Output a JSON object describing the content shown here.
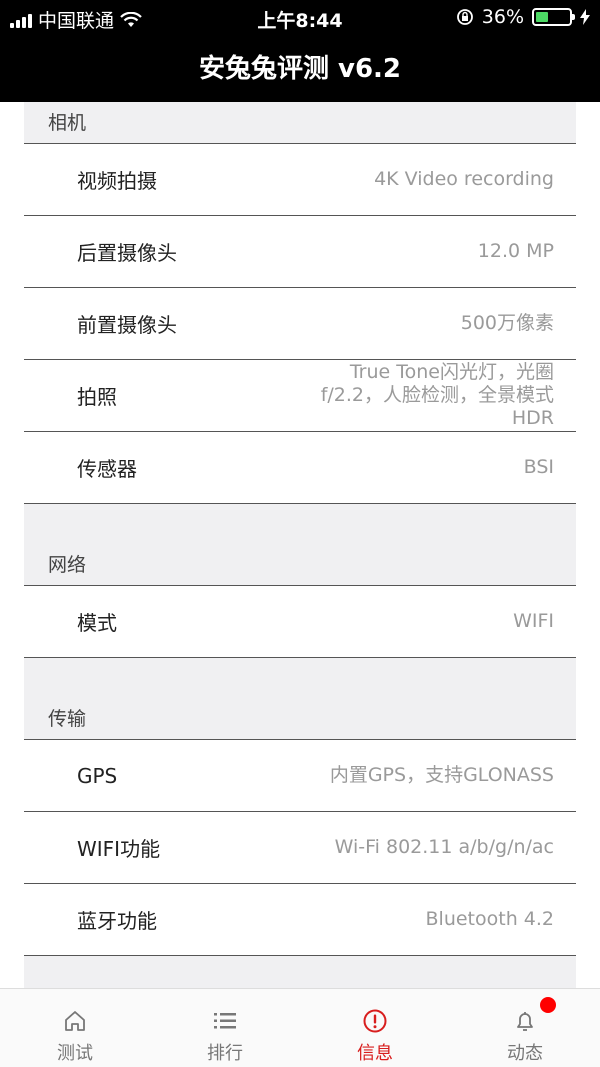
{
  "status_bar": {
    "carrier": "中国联通",
    "time": "上午8:44",
    "battery": "36%",
    "battery_level": 0.36
  },
  "navbar": {
    "title": "安兔兔评测 v6.2"
  },
  "sections": [
    {
      "header": "相机",
      "rows": [
        {
          "label": "视频拍摄",
          "value": "4K Video recording"
        },
        {
          "label": "后置摄像头",
          "value": "12.0 MP"
        },
        {
          "label": "前置摄像头",
          "value": "500万像素"
        },
        {
          "label": "拍照",
          "value": "True Tone闪光灯，光圈f/2.2，人脸检测，全景模式HDR"
        },
        {
          "label": "传感器",
          "value": "BSI"
        }
      ]
    },
    {
      "header": "网络",
      "rows": [
        {
          "label": "模式",
          "value": "WIFI"
        }
      ]
    },
    {
      "header": "传输",
      "rows": [
        {
          "label": "GPS",
          "value": "内置GPS，支持GLONASS"
        },
        {
          "label": "WIFI功能",
          "value": "Wi-Fi 802.11 a/b/g/n/ac"
        },
        {
          "label": "蓝牙功能",
          "value": "Bluetooth 4.2"
        }
      ]
    }
  ],
  "tabs": [
    {
      "label": "测试",
      "icon": "home-icon"
    },
    {
      "label": "排行",
      "icon": "list-icon"
    },
    {
      "label": "信息",
      "icon": "info-alert-icon",
      "active": true
    },
    {
      "label": "动态",
      "icon": "bell-icon",
      "has_badge": true
    }
  ],
  "colors": {
    "accent": "#d81e1e",
    "badge": "#ff0000",
    "battery": "#4cd964"
  }
}
